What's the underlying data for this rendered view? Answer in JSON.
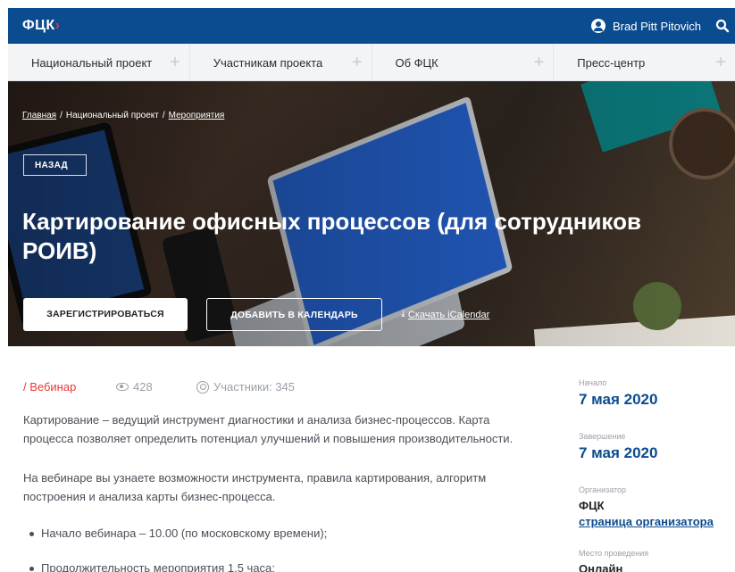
{
  "header": {
    "logo_text": "ФЦК",
    "logo_mark": "›",
    "user_name": "Brad Pitt Pitovich",
    "user_icon": "user-circle-icon",
    "search_icon": "search-icon",
    "brand_color": "#0b4b8f",
    "accent_color": "#e53935"
  },
  "nav": {
    "items": [
      {
        "label": "Национальный проект",
        "icon": "plus-icon"
      },
      {
        "label": "Участникам проекта",
        "icon": "plus-icon"
      },
      {
        "label": "Об ФЦК",
        "icon": "plus-icon"
      },
      {
        "label": "Пресс-центр",
        "icon": "plus-icon"
      }
    ],
    "plus_glyph": "+"
  },
  "hero": {
    "breadcrumb": {
      "home": "Главная",
      "separator1": "/",
      "project": "Национальный проект",
      "separator2": "/",
      "events": "Мероприятия"
    },
    "back_label": "НАЗАД",
    "title": "Картирование офисных процессов (для сотрудников РОИВ)",
    "register_label": "ЗАРЕГИСТРИРОВАТЬСЯ",
    "calendar_label": "ДОБАВИТЬ В КАЛЕНДАРЬ",
    "ical_label": "Скачать iCalendar",
    "ical_icon": "download-icon",
    "ical_glyph": "⤓"
  },
  "event": {
    "type": "/ Вебинар",
    "views": "428",
    "participants": "Участники: 345",
    "description_1": "Картирование – ведущий инструмент диагностики и анализа бизнес-процессов. Карта процесса позволяет определить потенциал улучшений и повышения производительности.",
    "description_2": "На вебинаре вы узнаете возможности инструмента, правила картирования, алгоритм построения и анализа карты бизнес-процесса.",
    "bullets": [
      "Начало вебинара – 10.00 (по московскому времени);",
      "Продолжительность мероприятия 1,5 часа;"
    ]
  },
  "sidebar": {
    "start_label": "Начало",
    "start_date": "7 мая 2020",
    "end_label": "Завершение",
    "end_date": "7 мая 2020",
    "organizer_label": "Организатор",
    "organizer_name": "ФЦК",
    "organizer_link": "страница организатора",
    "venue_label": "Место проведения",
    "venue": "Онлайн"
  }
}
